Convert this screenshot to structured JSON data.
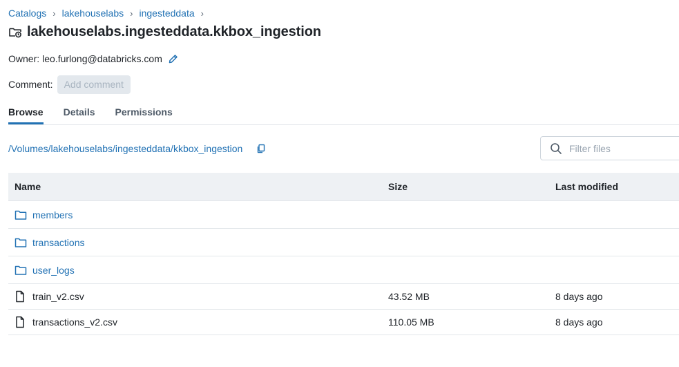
{
  "breadcrumb": {
    "items": [
      "Catalogs",
      "lakehouselabs",
      "ingesteddata"
    ],
    "separator": "›"
  },
  "volume": {
    "title": "lakehouselabs.ingesteddata.kkbox_ingestion",
    "icon": "volume-folder-icon"
  },
  "owner": {
    "label": "Owner:",
    "value": "leo.furlong@databricks.com",
    "edit_icon": "pencil-icon"
  },
  "comment": {
    "label": "Comment:",
    "button_label": "Add comment"
  },
  "tabs": [
    {
      "label": "Browse",
      "active": true
    },
    {
      "label": "Details",
      "active": false
    },
    {
      "label": "Permissions",
      "active": false
    }
  ],
  "path": {
    "value": "/Volumes/lakehouselabs/ingesteddata/kkbox_ingestion",
    "copy_icon": "copy-icon"
  },
  "filter": {
    "placeholder": "Filter files",
    "value": ""
  },
  "table": {
    "columns": [
      "Name",
      "Size",
      "Last modified"
    ],
    "rows": [
      {
        "type": "folder",
        "icon": "folder-icon",
        "name": "members",
        "size": "",
        "modified": ""
      },
      {
        "type": "folder",
        "icon": "folder-icon",
        "name": "transactions",
        "size": "",
        "modified": ""
      },
      {
        "type": "folder",
        "icon": "folder-icon",
        "name": "user_logs",
        "size": "",
        "modified": ""
      },
      {
        "type": "file",
        "icon": "file-icon",
        "name": "train_v2.csv",
        "size": "43.52 MB",
        "modified": "8 days ago"
      },
      {
        "type": "file",
        "icon": "file-icon",
        "name": "transactions_v2.csv",
        "size": "110.05 MB",
        "modified": "8 days ago"
      }
    ]
  },
  "colors": {
    "link": "#2272b4",
    "text": "#1f2328",
    "header_bg": "#eef1f4",
    "border": "#e2e6ea"
  }
}
